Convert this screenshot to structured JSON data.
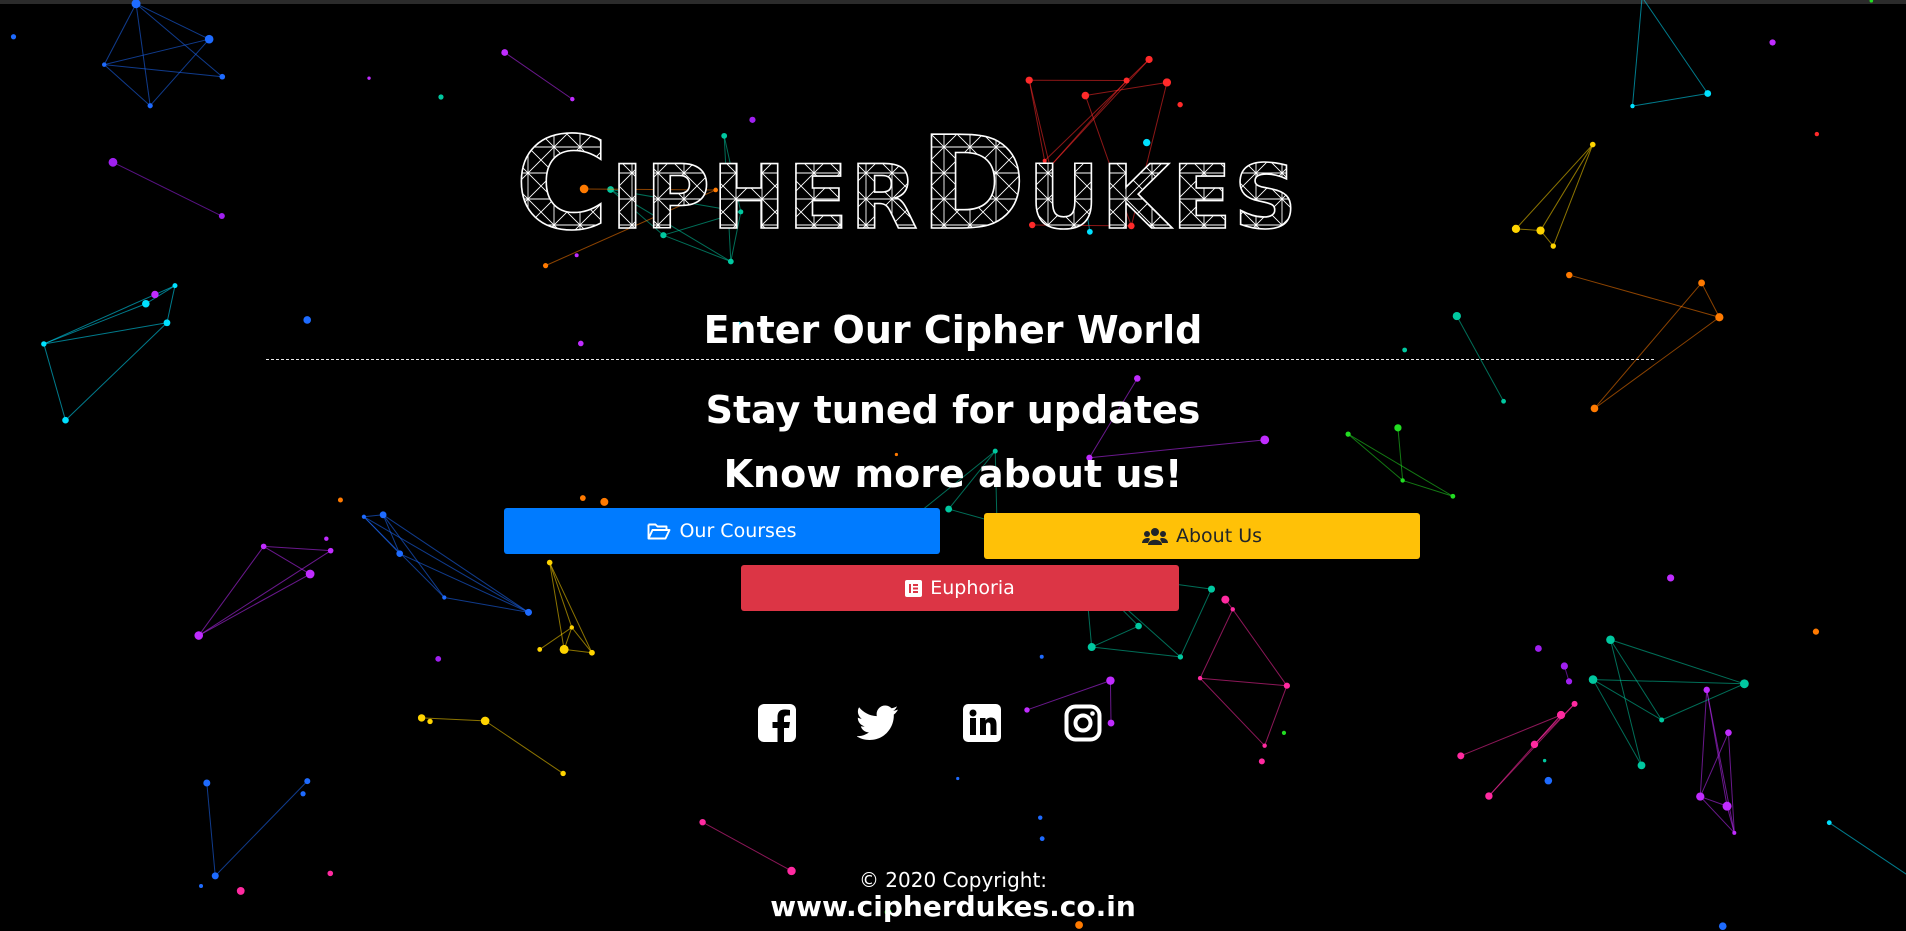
{
  "brand": {
    "logo_text": "CipherDukes",
    "logo_letters": [
      "C",
      "IPHER",
      "D",
      "UKES"
    ]
  },
  "hero": {
    "enter": "Enter Our Cipher World",
    "stay": "Stay tuned for updates",
    "know": "Know more about us!"
  },
  "buttons": {
    "courses": {
      "label": "Our Courses",
      "icon": "folder-open-icon",
      "color": "#007bff"
    },
    "about": {
      "label": "About Us",
      "icon": "users-icon",
      "color": "#ffc107"
    },
    "euphoria": {
      "label": "Euphoria",
      "icon": "elementor-icon",
      "color": "#dc3545"
    }
  },
  "social": [
    {
      "name": "facebook",
      "icon": "facebook-icon"
    },
    {
      "name": "twitter",
      "icon": "twitter-icon"
    },
    {
      "name": "linkedin",
      "icon": "linkedin-icon"
    },
    {
      "name": "instagram",
      "icon": "instagram-icon"
    }
  ],
  "footer": {
    "copyright": "© 2020 Copyright:",
    "site": "www.cipherdukes.co.in"
  }
}
